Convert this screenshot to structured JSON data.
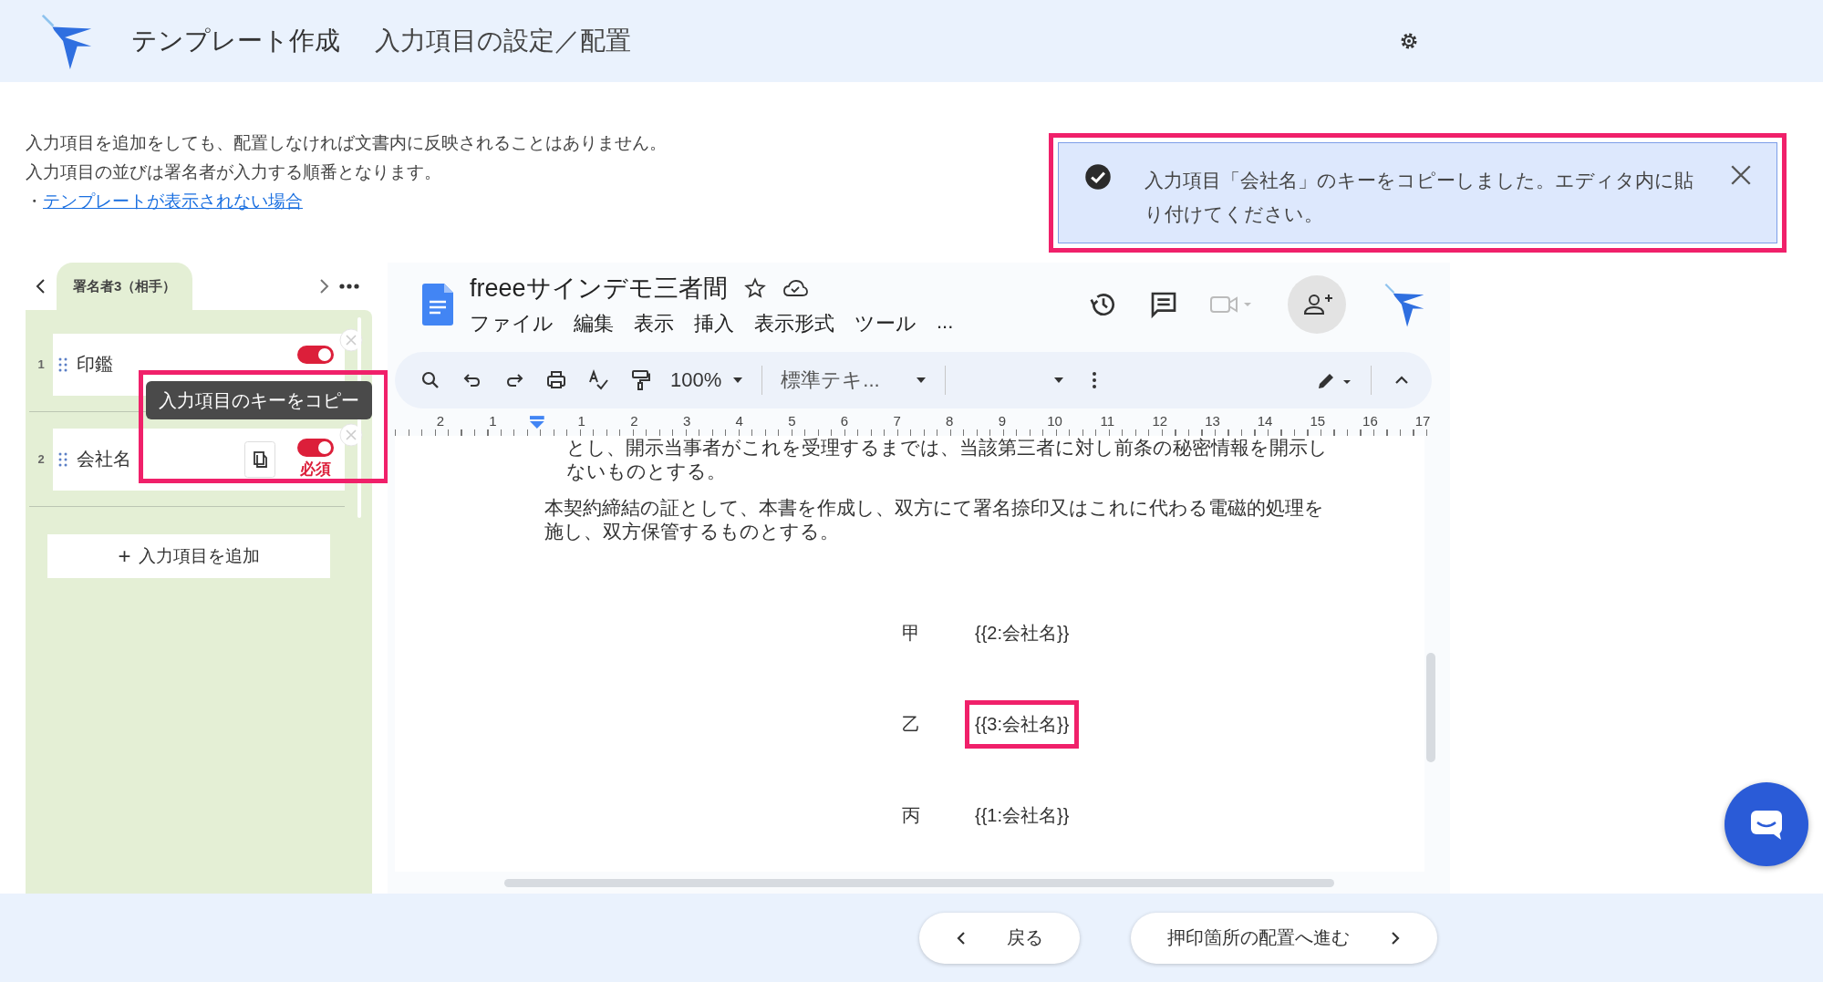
{
  "header": {
    "title": "テンプレート作成",
    "subtitle": "入力項目の設定／配置"
  },
  "instructions": {
    "lines": [
      "入力項目を追加をしても、配置しなければ文書内に反映されることはありません。",
      "入力項目の並びは署名者が入力する順番となります。"
    ],
    "bullet": "・",
    "help_link": "テンプレートが表示されない場合"
  },
  "notification": {
    "message": "入力項目「会社名」のキーをコピーしました。エディタ内に貼り付けてください。",
    "highlighted": true
  },
  "signer_panel": {
    "tab_label": "署名者3（相手）",
    "fields": [
      {
        "number": "1",
        "label": "印鑑",
        "required": true,
        "copy_button": false
      },
      {
        "number": "2",
        "label": "会社名",
        "required": true,
        "required_label": "必須",
        "copy_button": true
      }
    ],
    "tooltip": "入力項目のキーをコピー",
    "add_icon": "+",
    "add_button": "入力項目を追加"
  },
  "editor": {
    "doc_title": "freeeサインデモ三者間",
    "menus": [
      "ファイル",
      "編集",
      "表示",
      "挿入",
      "表示形式",
      "ツール",
      "..."
    ],
    "zoom": "100%",
    "style": "標準テキ...",
    "ruler": [
      "2",
      "1",
      "1",
      "2",
      "3",
      "4",
      "5",
      "6",
      "7",
      "8",
      "9",
      "10",
      "11",
      "12",
      "13",
      "14",
      "15",
      "16",
      "17"
    ],
    "paragraphs": [
      {
        "kind": "indented",
        "text": "とし、開示当事者がこれを受理するまでは、当該第三者に対し前条の秘密情報を開示しないものとする。"
      },
      {
        "kind": "plain",
        "text": "本契約締結の証として、本書を作成し、双方にて署名捺印又はこれに代わる電磁的処理を施し、双方保管するものとする。"
      }
    ],
    "signatures": [
      {
        "party": "甲",
        "key": "{{2:会社名}}",
        "highlighted": false
      },
      {
        "party": "乙",
        "key": "{{3:会社名}}",
        "highlighted": true
      },
      {
        "party": "丙",
        "key": "{{1:会社名}}",
        "highlighted": false
      }
    ]
  },
  "footer": {
    "back": "戻る",
    "next": "押印箇所の配置へ進む"
  }
}
